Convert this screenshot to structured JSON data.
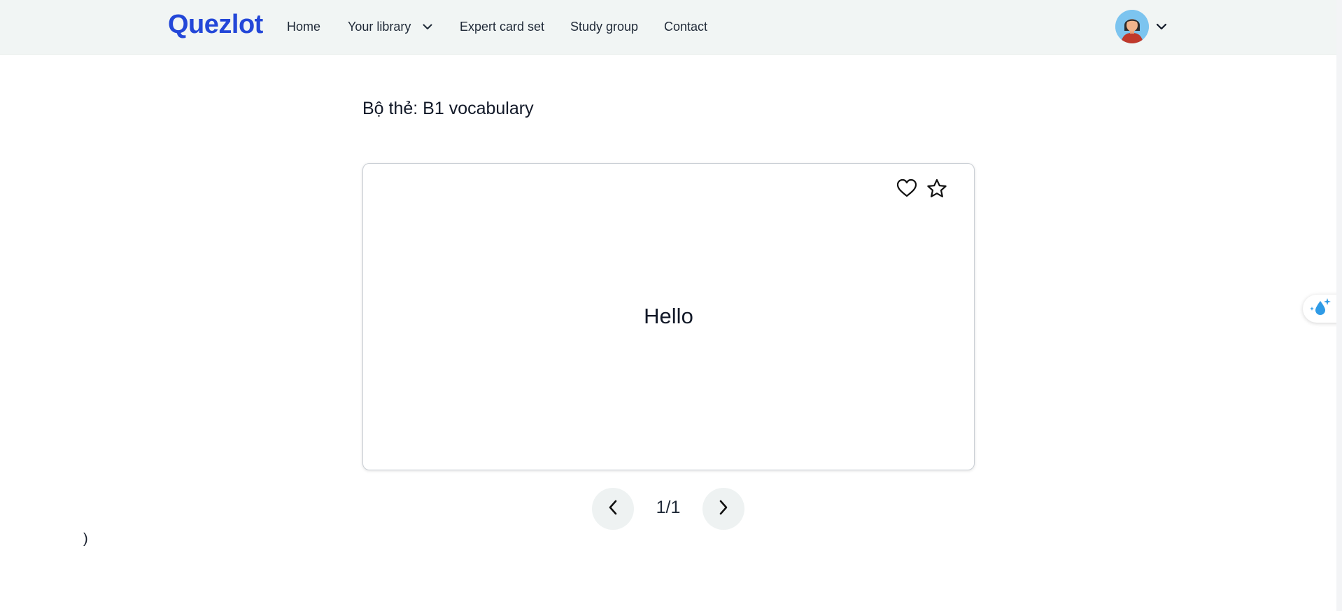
{
  "navbar": {
    "logo": "Quezlot",
    "items": [
      {
        "label": "Home"
      },
      {
        "label": "Your library"
      },
      {
        "label": "Expert card set"
      },
      {
        "label": "Study group"
      },
      {
        "label": "Contact"
      }
    ]
  },
  "deck": {
    "title": "Bộ thẻ: B1 vocabulary"
  },
  "card": {
    "front_text": "Hello"
  },
  "pagination": {
    "counter": "1/1"
  },
  "stray": {
    "text": ")"
  },
  "colors": {
    "brand": "#2347d8",
    "navbar_bg": "#f1f5f4",
    "button_bg": "#eef2f2",
    "widget_accent": "#2f9be6"
  },
  "icons": {
    "library_dropdown": "chevron-down-icon",
    "avatar_dropdown": "chevron-down-icon",
    "favorite": "heart-icon",
    "bookmark": "star-icon",
    "previous": "chevron-left-icon",
    "next": "chevron-right-icon",
    "widget": "sparkle-droplet-icon"
  }
}
